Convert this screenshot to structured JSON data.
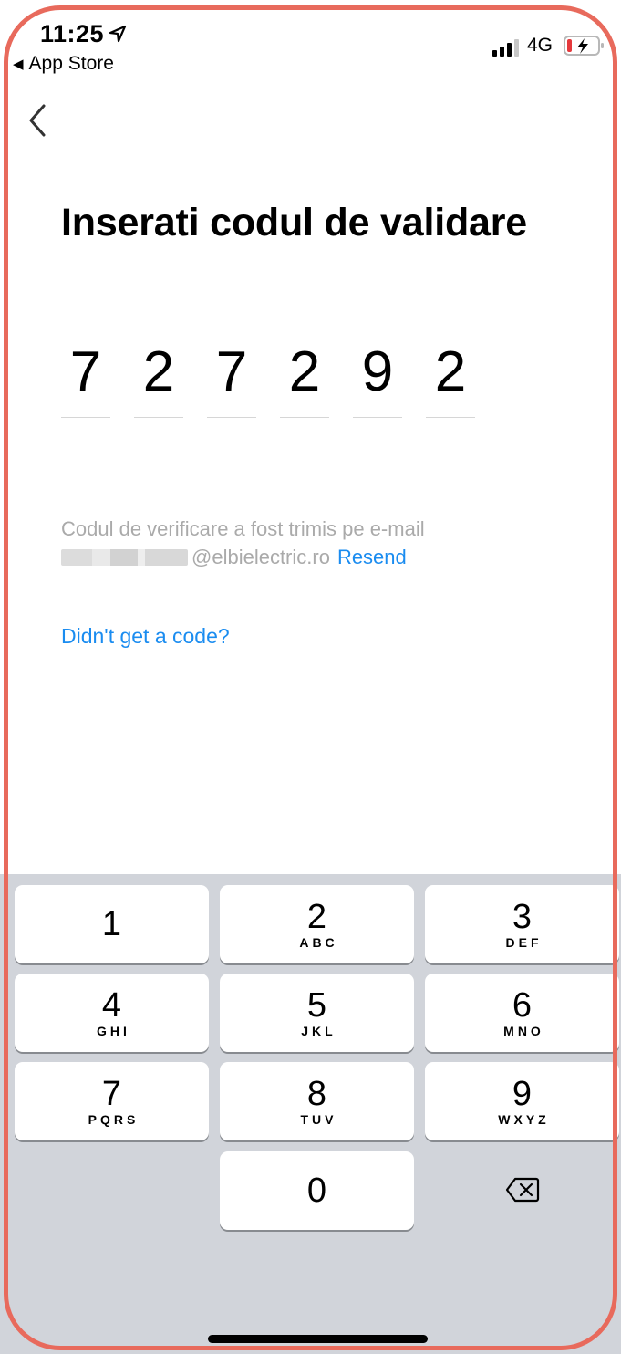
{
  "status_bar": {
    "time": "11:25",
    "back_to_app": "App Store",
    "network": "4G"
  },
  "page": {
    "title": "Inserati codul de validare",
    "code_digits": [
      "7",
      "2",
      "7",
      "2",
      "9",
      "2"
    ],
    "info_line1": "Codul de verificare a fost trimis pe e-mail",
    "email_domain": "@elbielectric.ro",
    "resend_label": "Resend",
    "help_link": "Didn't get a code?"
  },
  "keypad": {
    "keys": [
      {
        "num": "1",
        "letters": ""
      },
      {
        "num": "2",
        "letters": "ABC"
      },
      {
        "num": "3",
        "letters": "DEF"
      },
      {
        "num": "4",
        "letters": "GHI"
      },
      {
        "num": "5",
        "letters": "JKL"
      },
      {
        "num": "6",
        "letters": "MNO"
      },
      {
        "num": "7",
        "letters": "PQRS"
      },
      {
        "num": "8",
        "letters": "TUV"
      },
      {
        "num": "9",
        "letters": "WXYZ"
      },
      {
        "num": "0",
        "letters": ""
      }
    ]
  },
  "colors": {
    "accent": "#1a8cf0",
    "frame": "#e86a5c",
    "keyboard_bg": "#d1d4da",
    "battery_low": "#e5393c"
  }
}
